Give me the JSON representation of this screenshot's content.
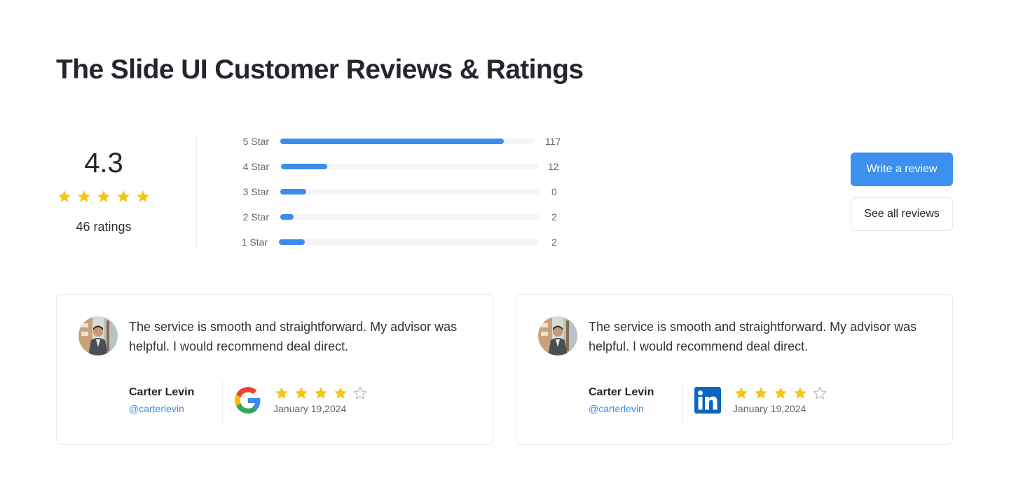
{
  "title": "The Slide UI Customer Reviews & Ratings",
  "summary": {
    "average": "4.3",
    "average_stars_filled": 5,
    "ratings_count_label": "46 ratings"
  },
  "distribution": [
    {
      "label": "5 Star",
      "count": "117",
      "fill_fraction": 0.88
    },
    {
      "label": "4 Star",
      "count": "12",
      "fill_fraction": 0.18
    },
    {
      "label": "3 Star",
      "count": "0",
      "fill_fraction": 0.1
    },
    {
      "label": "2 Star",
      "count": "2",
      "fill_fraction": 0.05
    },
    {
      "label": "1 Star",
      "count": "2",
      "fill_fraction": 0.1
    }
  ],
  "actions": {
    "write_review": "Write a review",
    "see_all": "See all reviews"
  },
  "reviews": [
    {
      "text": "The service is smooth and straightforward. My advisor was helpful. I would recommend deal direct.",
      "name": "Carter Levin",
      "handle": "@carterlevin",
      "source_icon": "google-icon",
      "rating": 4,
      "max_rating": 5,
      "date": "January 19,2024"
    },
    {
      "text": "The service is smooth and straightforward. My advisor was helpful. I would recommend deal direct.",
      "name": "Carter Levin",
      "handle": "@carterlevin",
      "source_icon": "linkedin-icon",
      "rating": 4,
      "max_rating": 5,
      "date": "January 19,2024"
    }
  ],
  "colors": {
    "accent": "#3d8ff0",
    "star": "#f5c518",
    "star_empty": "#b9bec6"
  }
}
